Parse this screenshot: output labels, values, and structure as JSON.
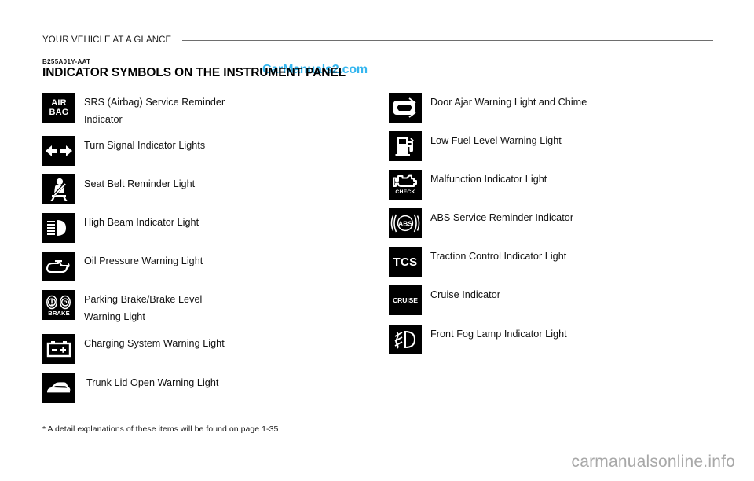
{
  "header": {
    "running_head": "YOUR VEHICLE AT A GLANCE",
    "section_code": "B255A01Y-AAT",
    "title": "INDICATOR SYMBOLS ON THE INSTRUMENT PANEL"
  },
  "watermarks": {
    "top": "CarManuals2.com",
    "bottom": "carmanualsonline.info",
    "top_color": "#35b6ef",
    "bottom_color": "#a8a8a8"
  },
  "left_column": [
    {
      "icon": "airbag-icon",
      "icon_text_line1": "AIR",
      "icon_text_line2": "BAG",
      "label": "SRS (Airbag) Service Reminder\nIndicator"
    },
    {
      "icon": "turn-signal-icon",
      "label": "Turn Signal Indicator Lights"
    },
    {
      "icon": "seat-belt-icon",
      "label": "Seat Belt Reminder Light"
    },
    {
      "icon": "high-beam-icon",
      "label": "High Beam Indicator Light"
    },
    {
      "icon": "oil-pressure-icon",
      "label": "Oil Pressure Warning Light"
    },
    {
      "icon": "parking-brake-icon",
      "icon_text": "BRAKE",
      "label": "Parking Brake/Brake Level\nWarning Light"
    },
    {
      "icon": "charging-system-icon",
      "label": "Charging System Warning Light"
    },
    {
      "icon": "trunk-lid-icon",
      "label": "Trunk Lid Open Warning Light"
    }
  ],
  "right_column": [
    {
      "icon": "door-ajar-icon",
      "label": "Door Ajar Warning Light and Chime"
    },
    {
      "icon": "low-fuel-icon",
      "label": "Low Fuel Level Warning Light"
    },
    {
      "icon": "malfunction-icon",
      "icon_text": "CHECK",
      "label": "Malfunction Indicator Light"
    },
    {
      "icon": "abs-icon",
      "icon_text": "ABS",
      "label": "ABS Service Reminder Indicator"
    },
    {
      "icon": "traction-control-icon",
      "icon_text": "TCS",
      "label": "Traction Control Indicator Light"
    },
    {
      "icon": "cruise-icon",
      "icon_text": "CRUISE",
      "label": "Cruise Indicator"
    },
    {
      "icon": "front-fog-lamp-icon",
      "label": "Front Fog Lamp Indicator Light"
    }
  ],
  "footnote": "* A detail explanations of these items will be found on page 1-35"
}
